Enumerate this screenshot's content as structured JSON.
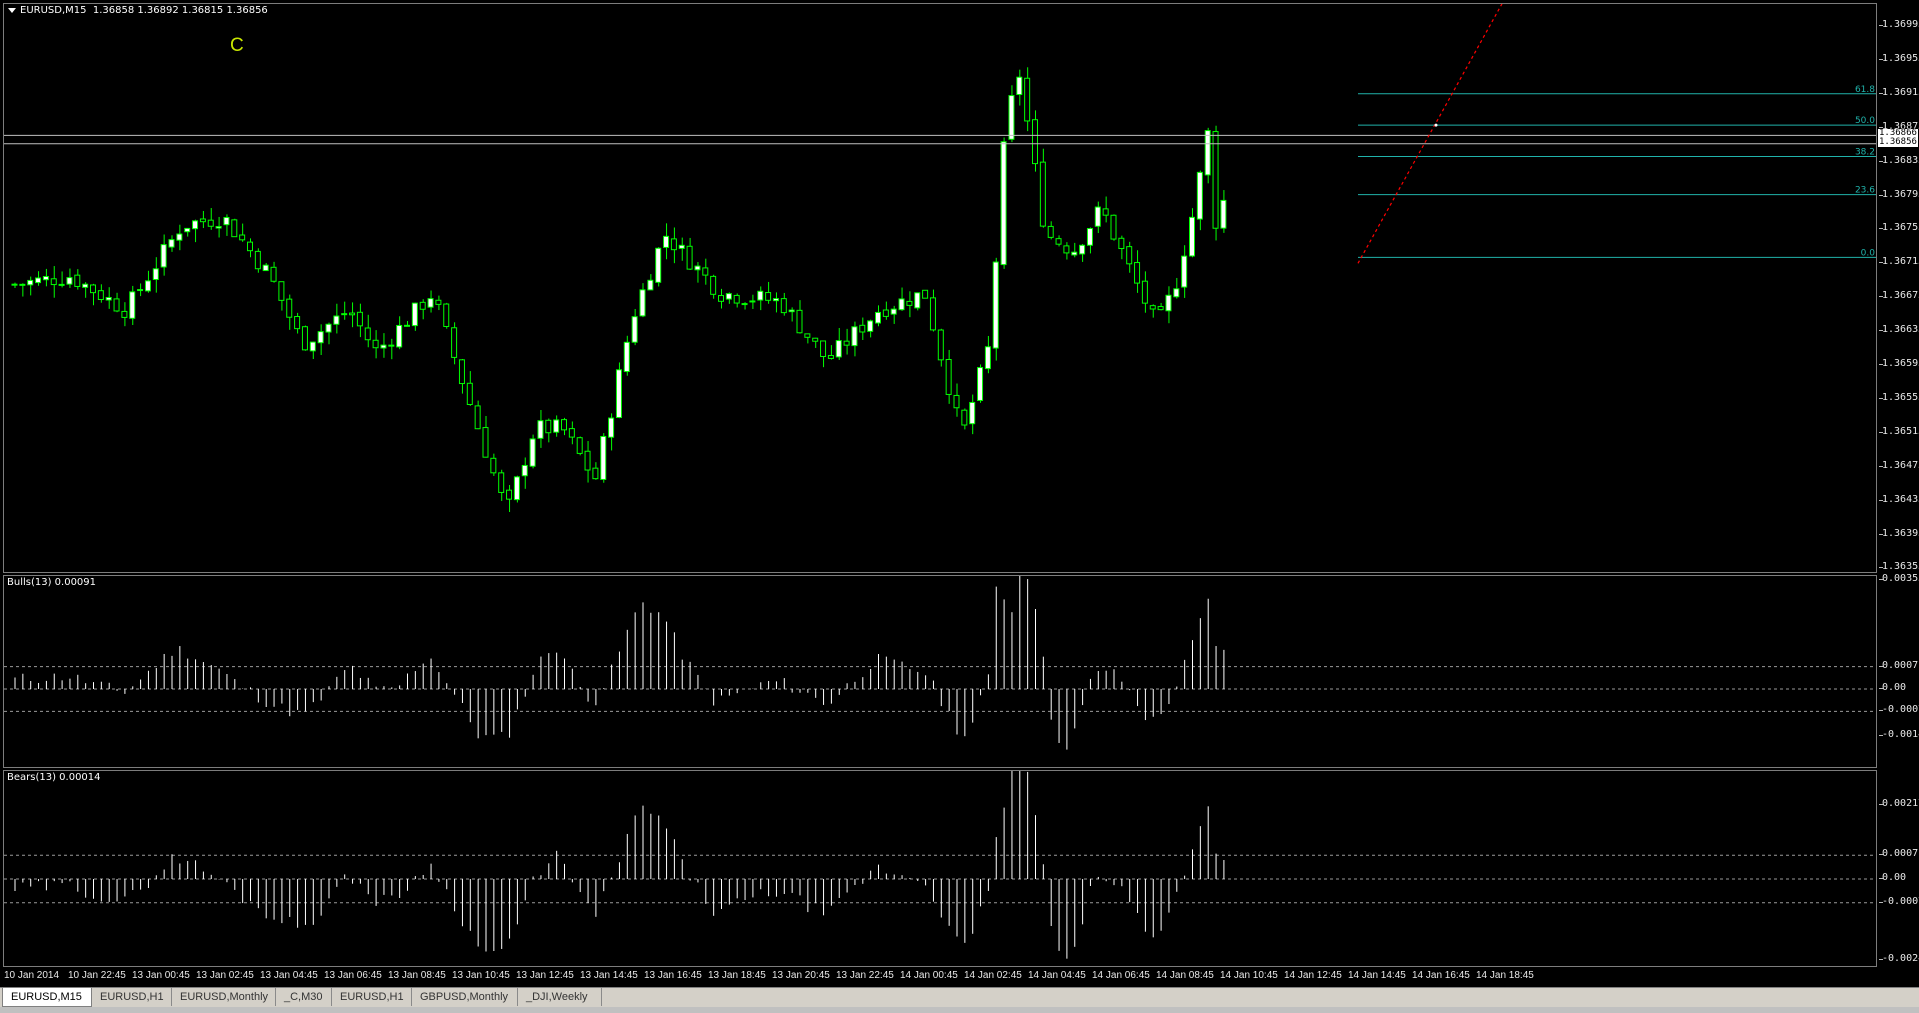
{
  "header": {
    "symbol": "EURUSD,M15",
    "ohlc": "1.36858 1.36892 1.36815 1.36856",
    "marker": "C"
  },
  "price_axis": [
    "1.36995",
    "1.36955",
    "1.36915",
    "1.36875",
    "1.36835",
    "1.36795",
    "1.36755",
    "1.36715",
    "1.36675",
    "1.36635",
    "1.36595",
    "1.36555",
    "1.36515",
    "1.36475",
    "1.36435",
    "1.36395",
    "1.36355"
  ],
  "current_price_boxes": [
    "1.36866",
    "1.36856"
  ],
  "fibonacci": {
    "levels": [
      {
        "label": "61.8",
        "price": 1.36915
      },
      {
        "label": "50.0",
        "price": 1.36878
      },
      {
        "label": "38.2",
        "price": 1.36841
      },
      {
        "label": "23.6",
        "price": 1.36796
      },
      {
        "label": "0.0",
        "price": 1.36722
      }
    ],
    "color": "#20b2aa"
  },
  "indicators": {
    "bulls": {
      "label": "Bulls(13) 0.00091",
      "axis": [
        "0.00355",
        "0.0007",
        "0.00",
        "-0.0007",
        "-0.00148"
      ]
    },
    "bears": {
      "label": "Bears(13) 0.00014",
      "axis": [
        "0.00217",
        "0.0007",
        "0.00",
        "-0.0007",
        "-0.00244"
      ]
    }
  },
  "time_axis": [
    "10 Jan 2014",
    "10 Jan 22:45",
    "13 Jan 00:45",
    "13 Jan 02:45",
    "13 Jan 04:45",
    "13 Jan 06:45",
    "13 Jan 08:45",
    "13 Jan 10:45",
    "13 Jan 12:45",
    "13 Jan 14:45",
    "13 Jan 16:45",
    "13 Jan 18:45",
    "13 Jan 20:45",
    "13 Jan 22:45",
    "14 Jan 00:45",
    "14 Jan 02:45",
    "14 Jan 04:45",
    "14 Jan 06:45",
    "14 Jan 08:45",
    "14 Jan 10:45",
    "14 Jan 12:45",
    "14 Jan 14:45",
    "14 Jan 16:45",
    "14 Jan 18:45"
  ],
  "tabs": [
    "EURUSD,M15",
    "EURUSD,H1",
    "EURUSD,Monthly",
    "_C,M30",
    "EURUSD,H1",
    "GBPUSD,Monthly",
    "_DJI,Weekly"
  ],
  "active_tab": 0,
  "colors": {
    "background": "#000000",
    "bull_candle": "#ffffff",
    "bear_candle": "#000000",
    "wick": "#00ff00",
    "grid_level": "#c0c0c0",
    "trend_line": "#ff0000",
    "histogram": "#ffffff"
  }
}
